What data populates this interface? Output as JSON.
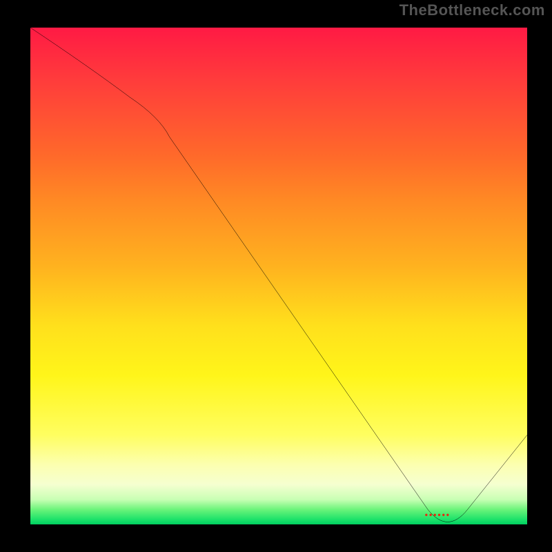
{
  "attribution": "TheBottleneck.com",
  "marker_label": "••••••",
  "chart_data": {
    "type": "line",
    "title": "",
    "xlabel": "",
    "ylabel": "",
    "ylim": [
      0,
      100
    ],
    "x": [
      0,
      25,
      85,
      100
    ],
    "values": [
      100,
      82,
      0,
      18
    ],
    "marker": {
      "x": 82,
      "y": 2
    },
    "notes": "Single black curve over vertical green→yellow→red gradient. Values are percentages of plot height, estimated visually."
  }
}
